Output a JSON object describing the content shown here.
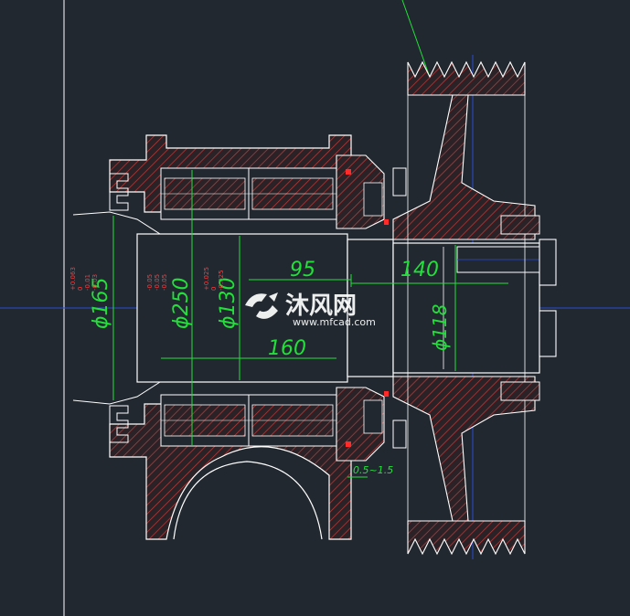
{
  "colors": {
    "background": "#212830",
    "outline": "#ffffff",
    "hatch": "#c23b3b",
    "dimension": "#22e03a",
    "tolerance": "#ff3a3a",
    "centerline": "#2a4bd6",
    "border": "#ffffff"
  },
  "dimensions": {
    "d165": "ϕ165",
    "d250": "ϕ250",
    "d130": "ϕ130",
    "d118": "ϕ118",
    "len95": "95",
    "len140": "140",
    "len160": "160",
    "gap": "0.5~1.5"
  },
  "tolerances": {
    "t165": [
      "+0.063",
      "0",
      "-0.01",
      "-0.03"
    ],
    "t250": [
      "-0.05",
      "-0.05",
      "-0.05"
    ],
    "t130": [
      "+0.025",
      "0",
      "-0.025"
    ]
  },
  "watermark": {
    "brand": "沐风网",
    "url": "www.mfcad.com",
    "icon": "mfcad-logo-icon"
  }
}
